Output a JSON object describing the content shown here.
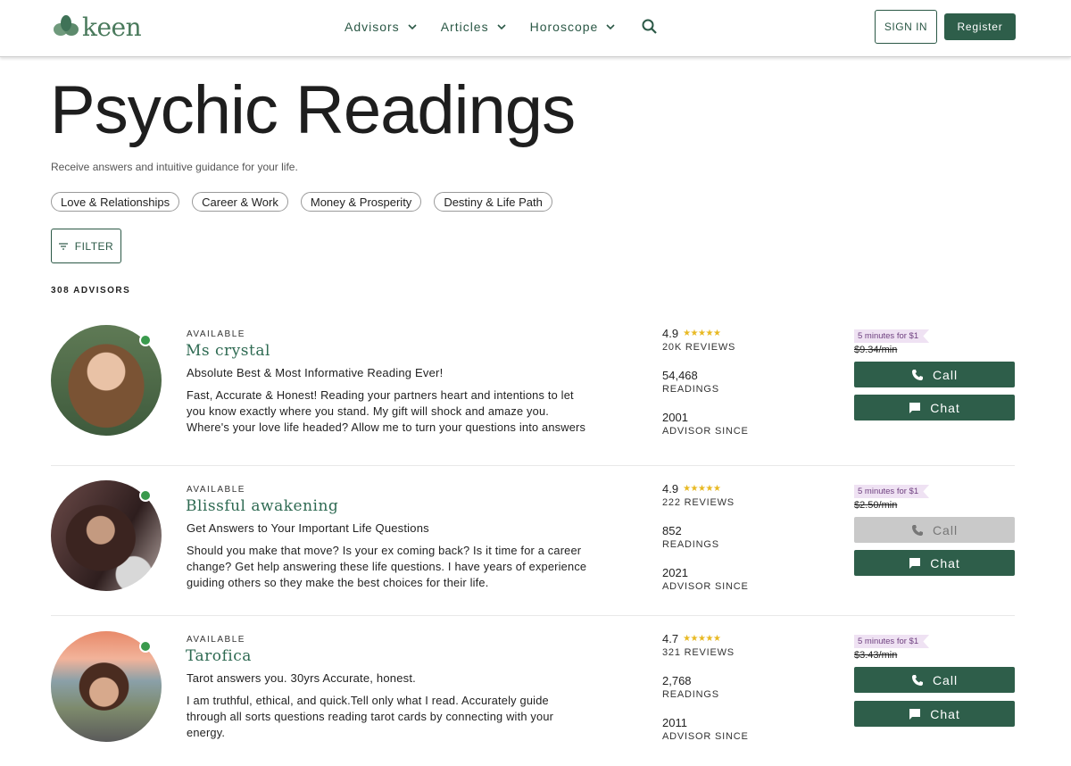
{
  "header": {
    "logo_text": "keen",
    "nav": [
      {
        "label": "Advisors"
      },
      {
        "label": "Articles"
      },
      {
        "label": "Horoscope"
      }
    ],
    "signin_label": "SIGN IN",
    "register_label": "Register",
    "brand_color": "#2e5e4a"
  },
  "hero": {
    "title": "Psychic Readings",
    "subtitle": "Receive answers and intuitive guidance for your life.",
    "chips": [
      "Love & Relationships",
      "Career & Work",
      "Money & Prosperity",
      "Destiny & Life Path"
    ],
    "filter_label": "FILTER",
    "advisor_count": "308 ADVISORS"
  },
  "advisors": [
    {
      "status": "AVAILABLE",
      "name": "Ms crystal",
      "tagline": "Absolute Best & Most Informative Reading Ever!",
      "description": "Fast, Accurate & Honest! Reading your partners heart and intentions to let you know exactly where you stand. My gift will shock and amaze you. Where's your love life headed? Allow me to turn your questions into answers",
      "rating": "4.9",
      "reviews": "20K REVIEWS",
      "readings": "54,468",
      "readings_label": "READINGS",
      "since": "2001",
      "since_label": "ADVISOR SINCE",
      "promo": "5 minutes for $1",
      "price": "$9.34/min",
      "call_label": "Call",
      "chat_label": "Chat",
      "call_enabled": true
    },
    {
      "status": "AVAILABLE",
      "name": "Blissful awakening",
      "tagline": "Get Answers to Your Important Life Questions",
      "description": "Should you make that move? Is your ex coming back? Is it time for a career change? Get help answering these life questions. I have years of experience guiding others so they make the best choices for their life.",
      "rating": "4.9",
      "reviews": "222 REVIEWS",
      "readings": "852",
      "readings_label": "READINGS",
      "since": "2021",
      "since_label": "ADVISOR SINCE",
      "promo": "5 minutes for $1",
      "price": "$2.50/min",
      "call_label": "Call",
      "chat_label": "Chat",
      "call_enabled": false
    },
    {
      "status": "AVAILABLE",
      "name": "Tarofica",
      "tagline": "Tarot answers you. 30yrs Accurate, honest.",
      "description": "I am truthful, ethical, and quick.Tell only what I read. Accurately guide through all sorts questions reading tarot cards by connecting with your energy.",
      "rating": "4.7",
      "reviews": "321 REVIEWS",
      "readings": "2,768",
      "readings_label": "READINGS",
      "since": "2011",
      "since_label": "ADVISOR SINCE",
      "promo": "5 minutes for $1",
      "price": "$3.43/min",
      "call_label": "Call",
      "chat_label": "Chat",
      "call_enabled": true
    }
  ]
}
